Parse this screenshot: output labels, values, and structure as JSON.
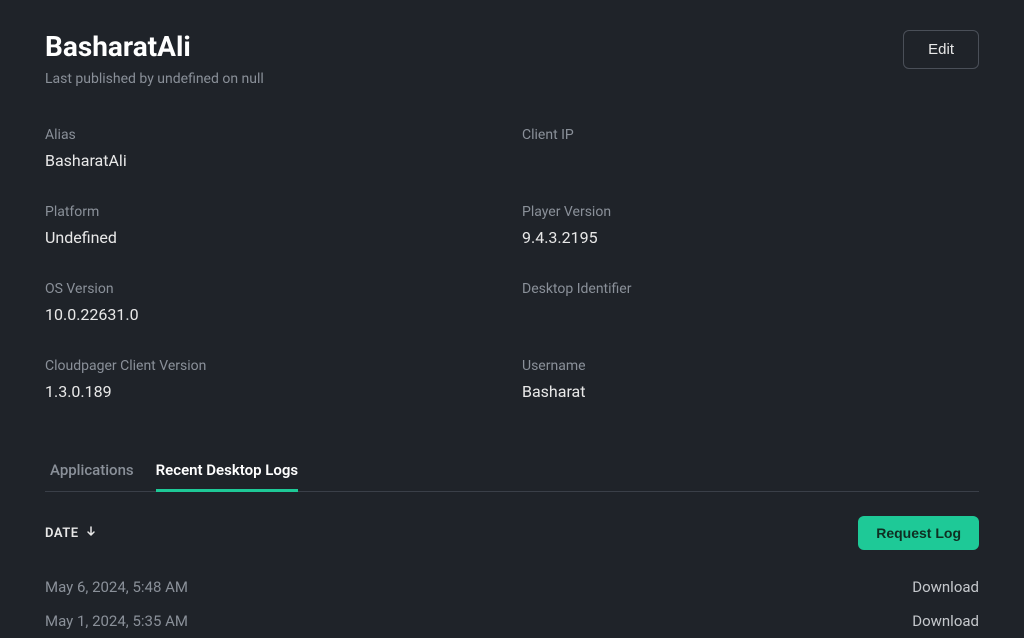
{
  "header": {
    "title": "BasharatAli",
    "subtitle": "Last published by undefined on null",
    "edit_label": "Edit"
  },
  "details": {
    "alias_label": "Alias",
    "alias_value": "BasharatAli",
    "client_ip_label": "Client IP",
    "client_ip_value": "",
    "platform_label": "Platform",
    "platform_value": "Undefined",
    "player_version_label": "Player Version",
    "player_version_value": "9.4.3.2195",
    "os_version_label": "OS Version",
    "os_version_value": "10.0.22631.0",
    "desktop_identifier_label": "Desktop Identifier",
    "desktop_identifier_value": "",
    "cloudpager_label": "Cloudpager Client Version",
    "cloudpager_value": "1.3.0.189",
    "username_label": "Username",
    "username_value": "Basharat"
  },
  "tabs": {
    "applications": "Applications",
    "recent_logs": "Recent Desktop Logs"
  },
  "table": {
    "date_header": "DATE",
    "request_log_label": "Request Log",
    "download_label": "Download",
    "rows": [
      {
        "date": "May 6, 2024, 5:48 AM"
      },
      {
        "date": "May 1, 2024, 5:35 AM"
      }
    ]
  }
}
